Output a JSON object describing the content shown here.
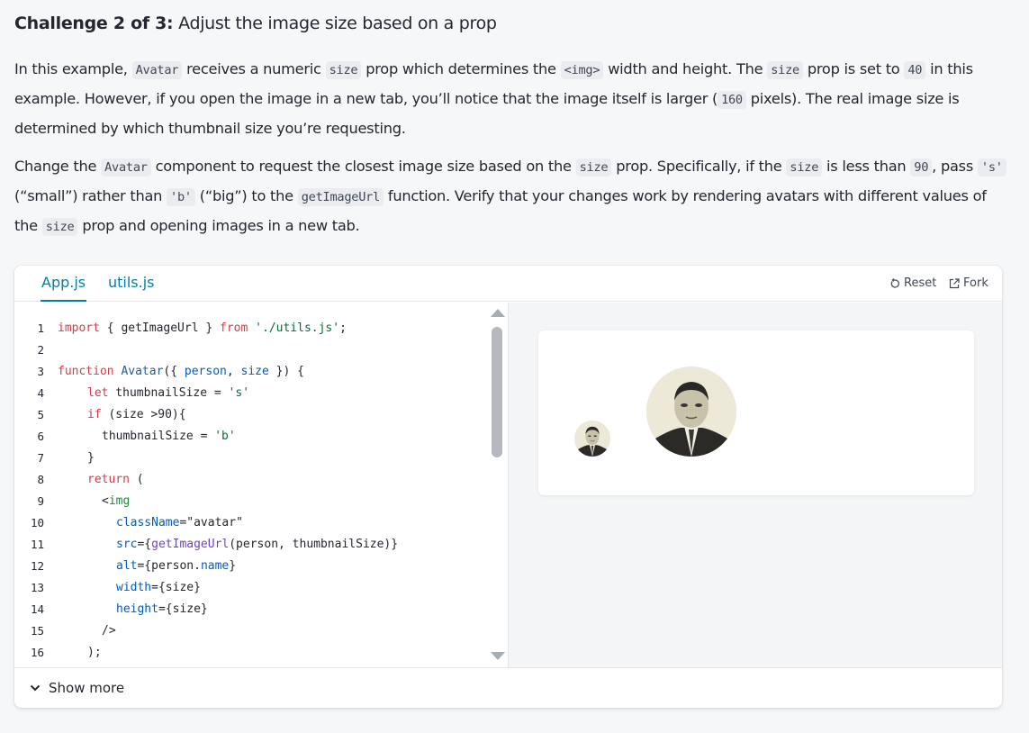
{
  "challenge": {
    "prefix": "Challenge 2 of 3:",
    "title": "Adjust the image size based on a prop"
  },
  "paragraph1": {
    "t1": "In this example, ",
    "c1": "Avatar",
    "t2": " receives a numeric ",
    "c2": "size",
    "t3": " prop which determines the ",
    "c3": "<img>",
    "t4": " width and height. The ",
    "c4": "size",
    "t5": " prop is set to ",
    "c5": "40",
    "t6": " in this example. However, if you open the image in a new tab, you’ll notice that the image itself is larger (",
    "c6": "160",
    "t7": " pixels). The real image size is determined by which thumbnail size you’re requesting."
  },
  "paragraph2": {
    "t1": "Change the ",
    "c1": "Avatar",
    "t2": " component to request the closest image size based on the ",
    "c2": "size",
    "t3": " prop. Specifically, if the ",
    "c3": "size",
    "t4": " is less than ",
    "c4": "90",
    "t5": ", pass ",
    "c5": "'s'",
    "t6": " (“small”) rather than ",
    "c6": "'b'",
    "t7": " (“big”) to the ",
    "c7": "getImageUrl",
    "t8": " function. Verify that your changes work by rendering avatars with different values of the ",
    "c8": "size",
    "t9": " prop and opening images in a new tab."
  },
  "sandbox": {
    "tabs": [
      "App.js",
      "utils.js"
    ],
    "reset_label": "Reset",
    "fork_label": "Fork",
    "show_more_label": "Show more"
  },
  "code": {
    "line_numbers": [
      "1",
      "2",
      "3",
      "4",
      "5",
      "6",
      "7",
      "8",
      "9",
      "10",
      "11",
      "12",
      "13",
      "14",
      "15",
      "16"
    ],
    "l1": {
      "a": "import",
      "b": " { getImageUrl } ",
      "c": "from",
      "d": " './utils.js'",
      "e": ";"
    },
    "l3": {
      "a": "function",
      "b": " ",
      "c": "Avatar",
      "d": "({ ",
      "e": "person",
      "f": ", ",
      "g": "size",
      "h": " }) {"
    },
    "l4": {
      "a": "let",
      "b": " thumbnailSize = ",
      "c": "'s'"
    },
    "l5": {
      "a": "if",
      "b": " (size >90){"
    },
    "l6": {
      "a": "thumbnailSize = ",
      "b": "'b'"
    },
    "l7": {
      "a": "}"
    },
    "l8": {
      "a": "return",
      "b": " ("
    },
    "l9": {
      "a": "<",
      "b": "img"
    },
    "l10": {
      "a": "className",
      "b": "=",
      "c": "\"avatar\""
    },
    "l11": {
      "a": "src",
      "b": "={",
      "c": "getImageUrl",
      "d": "(person, thumbnailSize)}"
    },
    "l12": {
      "a": "alt",
      "b": "={person.",
      "c": "name",
      "d": "}"
    },
    "l13": {
      "a": "width",
      "b": "={size}"
    },
    "l14": {
      "a": "height",
      "b": "={size}"
    },
    "l15": {
      "a": "/>"
    },
    "l16": {
      "a": ");"
    }
  },
  "colors": {
    "accent": "#087ea4",
    "keyword": "#d73a49",
    "function": "#6f42c1",
    "string": "#0a6b3a"
  }
}
